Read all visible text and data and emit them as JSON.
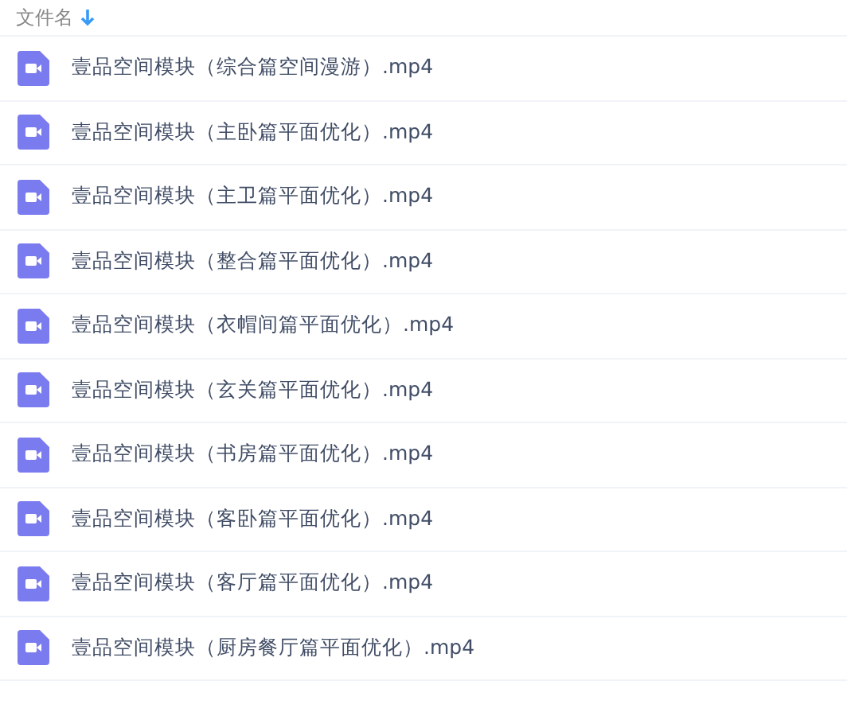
{
  "header": {
    "label": "文件名",
    "sort_descending": true
  },
  "files": [
    {
      "name": "壹品空间模块（综合篇空间漫游）.mp4",
      "kind": "video"
    },
    {
      "name": "壹品空间模块（主卧篇平面优化）.mp4",
      "kind": "video"
    },
    {
      "name": "壹品空间模块（主卫篇平面优化）.mp4",
      "kind": "video"
    },
    {
      "name": "壹品空间模块（整合篇平面优化）.mp4",
      "kind": "video"
    },
    {
      "name": "壹品空间模块（衣帽间篇平面优化）.mp4",
      "kind": "video"
    },
    {
      "name": "壹品空间模块（玄关篇平面优化）.mp4",
      "kind": "video"
    },
    {
      "name": "壹品空间模块（书房篇平面优化）.mp4",
      "kind": "video"
    },
    {
      "name": "壹品空间模块（客卧篇平面优化）.mp4",
      "kind": "video"
    },
    {
      "name": "壹品空间模块（客厅篇平面优化）.mp4",
      "kind": "video"
    },
    {
      "name": "壹品空间模块（厨房餐厅篇平面优化）.mp4",
      "kind": "video"
    }
  ]
}
